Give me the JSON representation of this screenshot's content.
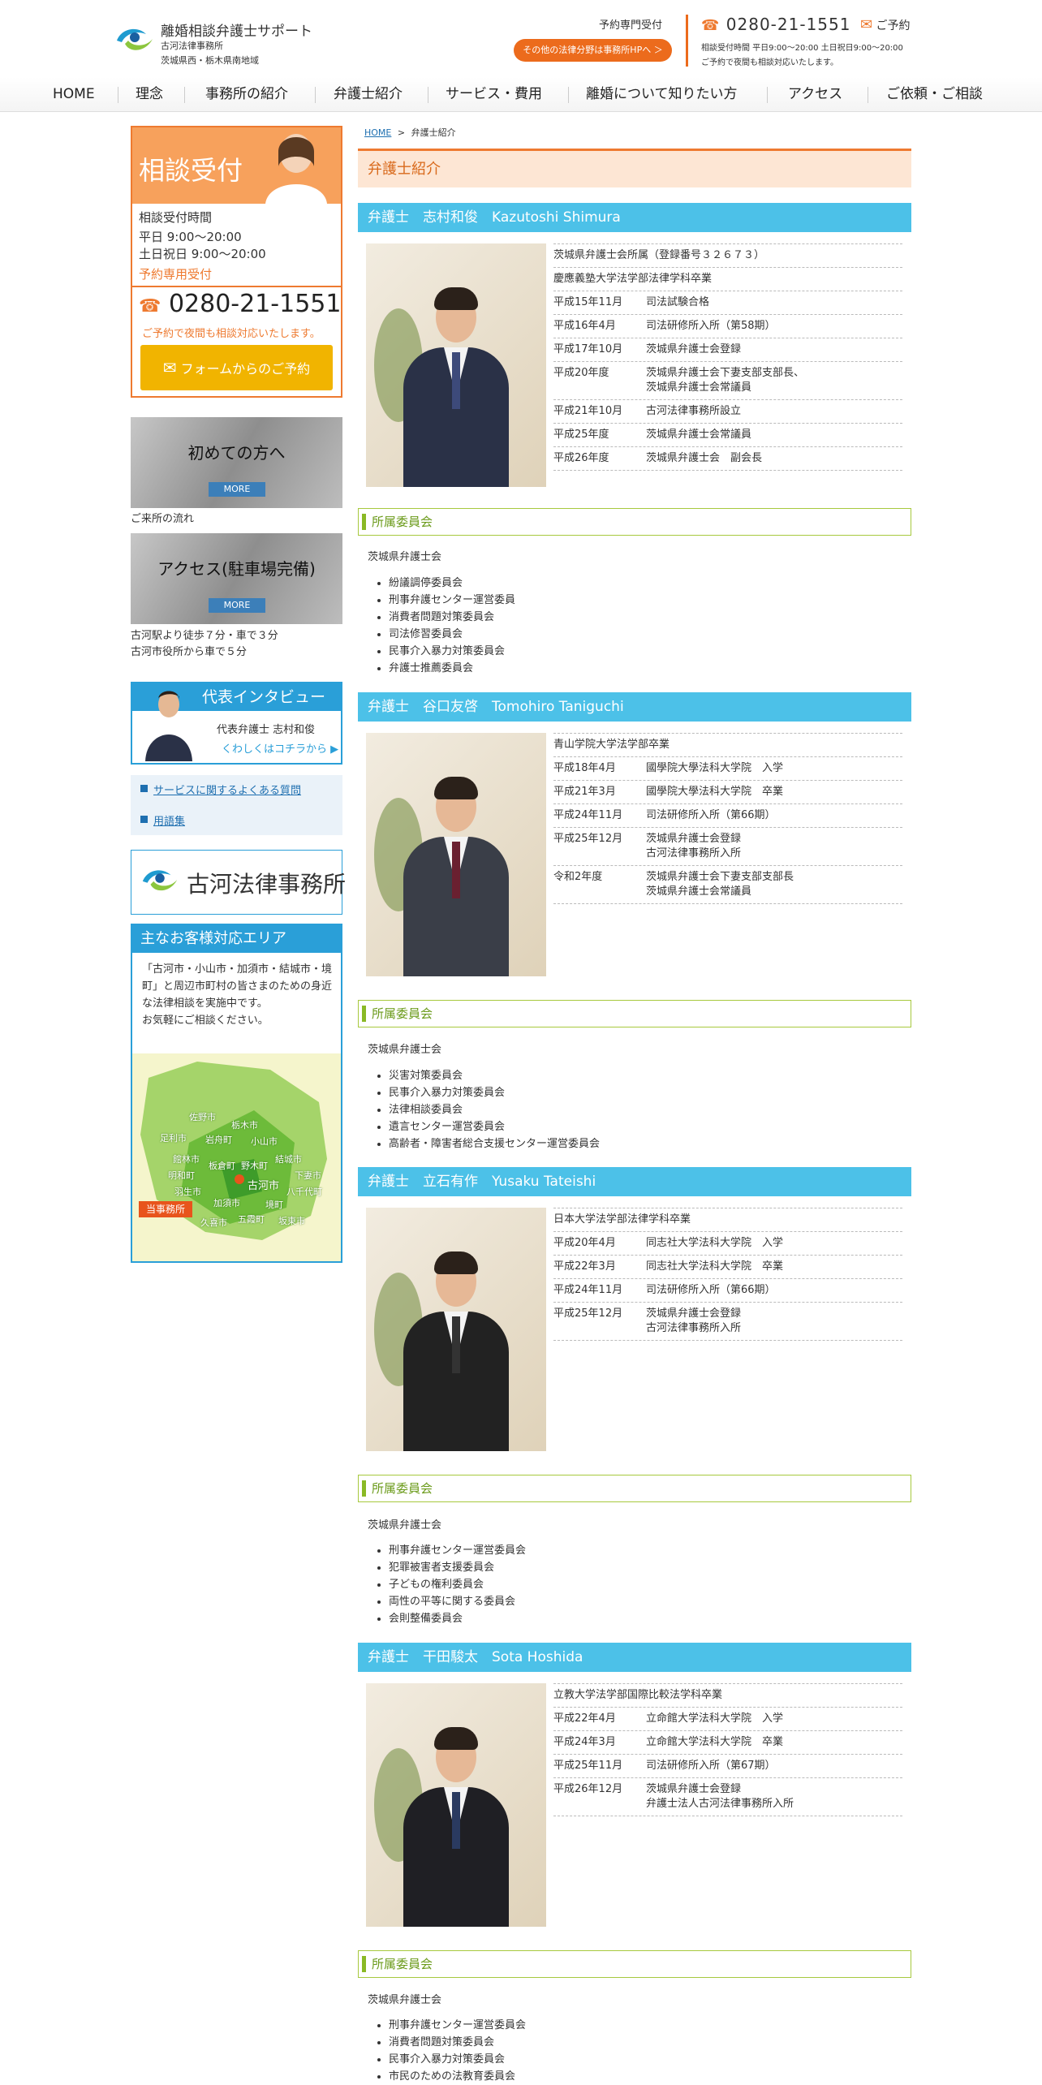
{
  "header": {
    "logo_title": "離婚相談弁護士サポート",
    "logo_sub1": "古河法律事務所",
    "logo_sub2": "茨城県西・栃木県南地域",
    "reserve_label": "予約専門受付",
    "other_fields_button": "その他の法律分野は事務所HPへ ＞",
    "phone": "0280-21-1551",
    "mail_label": "ご予約",
    "hours": "相談受付時間 平日9:00〜20:00 土日祝日9:00〜20:00",
    "night_note": "ご予約で夜間も相談対応いたします。"
  },
  "nav": [
    "HOME",
    "理念",
    "事務所の紹介",
    "弁護士紹介",
    "サービス・費用",
    "離婚について知りたい方",
    "アクセス",
    "ご依頼・ご相談"
  ],
  "sidebar": {
    "consult": {
      "title": "相談受付",
      "hours_label": "相談受付時間",
      "weekday": "平日 9:00〜20:00",
      "weekend": "土日祝日 9:00〜20:00",
      "reserve": "予約専用受付",
      "phone": "0280-21-1551",
      "night_note": "ご予約で夜間も相談対応いたします。",
      "form_button": "フォームからのご予約"
    },
    "first_time": {
      "title": "初めての方へ",
      "more": "MORE",
      "caption": "ご来所の流れ"
    },
    "access": {
      "title": "アクセス(駐車場完備)",
      "more": "MORE",
      "caption1": "古河駅より徒歩７分・車で３分",
      "caption2": "古河市役所から車で５分"
    },
    "interview": {
      "title": "代表インタビュー",
      "sub": "代表弁護士 志村和俊",
      "link": "くわしくはコチラから ▶"
    },
    "links": [
      "サービスに関するよくある質問",
      "用語集"
    ],
    "office": "古河法律事務所",
    "area": {
      "title": "主なお客様対応エリア",
      "text": "「古河市・小山市・加須市・結城市・境町」と周辺市町村の皆さまのための身近な法律相談を実施中です。\nお気軽にご相談ください。",
      "pin": "当事務所",
      "places": [
        "佐野市",
        "栃木市",
        "足利市",
        "岩舟町",
        "小山市",
        "結城市",
        "館林市",
        "板倉町",
        "野木町",
        "下妻市",
        "明和町",
        "古河市",
        "八千代町",
        "羽生市",
        "加須市",
        "境町",
        "久喜市",
        "五霞町",
        "坂東市"
      ]
    }
  },
  "main": {
    "breadcrumb_home": "HOME",
    "breadcrumb_sep": ">",
    "breadcrumb_current": "弁護士紹介",
    "page_title": "弁護士紹介",
    "committee_label": "所属委員会",
    "lawyers": [
      {
        "name": "弁護士　志村和俊　Kazutoshi Shimura",
        "career": [
          {
            "date": "",
            "text": "茨城県弁護士会所属（登録番号３２６７３）"
          },
          {
            "date": "",
            "text": "慶應義塾大学法学部法律学科卒業"
          },
          {
            "date": "平成15年11月",
            "text": "司法試験合格"
          },
          {
            "date": "平成16年4月",
            "text": "司法研修所入所（第58期）"
          },
          {
            "date": "平成17年10月",
            "text": "茨城県弁護士会登録"
          },
          {
            "date": "平成20年度",
            "text": "茨城県弁護士会下妻支部支部長、\n茨城県弁護士会常議員"
          },
          {
            "date": "平成21年10月",
            "text": "古河法律事務所設立"
          },
          {
            "date": "平成25年度",
            "text": "茨城県弁護士会常議員"
          },
          {
            "date": "平成26年度",
            "text": "茨城県弁護士会　副会長"
          }
        ],
        "org": "茨城県弁護士会",
        "committees": [
          "紛議調停委員会",
          "刑事弁護センター運営委員",
          "消費者問題対策委員会",
          "司法修習委員会",
          "民事介入暴力対策委員会",
          "弁護士推薦委員会"
        ]
      },
      {
        "name": "弁護士　谷口友啓　Tomohiro Taniguchi",
        "career": [
          {
            "date": "",
            "text": "青山学院大学法学部卒業"
          },
          {
            "date": "平成18年4月",
            "text": "國學院大學法科大学院　入学"
          },
          {
            "date": "平成21年3月",
            "text": "國學院大學法科大学院　卒業"
          },
          {
            "date": "平成24年11月",
            "text": "司法研修所入所（第66期）"
          },
          {
            "date": "平成25年12月",
            "text": "茨城県弁護士会登録\n古河法律事務所入所"
          },
          {
            "date": "令和2年度",
            "text": "茨城県弁護士会下妻支部支部長\n茨城県弁護士会常議員"
          }
        ],
        "org": "茨城県弁護士会",
        "committees": [
          "災害対策委員会",
          "民事介入暴力対策委員会",
          "法律相談委員会",
          "遺言センター運営委員会",
          "高齢者・障害者総合支援センター運営委員会"
        ]
      },
      {
        "name": "弁護士　立石有作　Yusaku Tateishi",
        "career": [
          {
            "date": "",
            "text": "日本大学法学部法律学科卒業"
          },
          {
            "date": "平成20年4月",
            "text": "同志社大学法科大学院　入学"
          },
          {
            "date": "平成22年3月",
            "text": "同志社大学法科大学院　卒業"
          },
          {
            "date": "平成24年11月",
            "text": "司法研修所入所（第66期）"
          },
          {
            "date": "平成25年12月",
            "text": "茨城県弁護士会登録\n古河法律事務所入所"
          }
        ],
        "org": "茨城県弁護士会",
        "committees": [
          "刑事弁護センター運営委員会",
          "犯罪被害者支援委員会",
          "子どもの権利委員会",
          "両性の平等に関する委員会",
          "会則整備委員会"
        ]
      },
      {
        "name": "弁護士　干田駿太　Sota Hoshida",
        "career": [
          {
            "date": "",
            "text": "立教大学法学部国際比較法学科卒業"
          },
          {
            "date": "平成22年4月",
            "text": "立命館大学法科大学院　入学"
          },
          {
            "date": "平成24年3月",
            "text": "立命館大学法科大学院　卒業"
          },
          {
            "date": "平成25年11月",
            "text": "司法研修所入所（第67期）"
          },
          {
            "date": "平成26年12月",
            "text": "茨城県弁護士会登録\n弁護士法人古河法律事務所入所"
          }
        ],
        "org": "茨城県弁護士会",
        "committees": [
          "刑事弁護センター運営委員会",
          "消費者問題対策委員会",
          "民事介入暴力対策委員会",
          "市民のための法教育委員会"
        ]
      }
    ]
  },
  "colors": {
    "accent_orange": "#ee7a30",
    "lawyer_blue": "#4cc1e8",
    "committee_green": "#8ab925",
    "link_blue": "#1e6fb0"
  }
}
